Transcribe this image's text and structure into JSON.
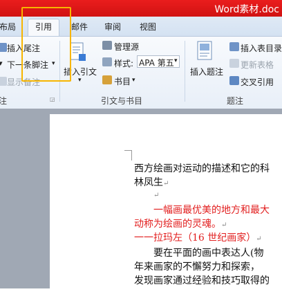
{
  "window": {
    "title": "Word素材.doc"
  },
  "tabs": [
    "布局",
    "引用",
    "邮件",
    "审阅",
    "视图"
  ],
  "ribbon": {
    "footnotes": {
      "insert_endnote": "插入尾注",
      "next_footnote": "下一条脚注",
      "show_notes": "显示备注",
      "group_label": "注"
    },
    "citations": {
      "insert_citation": "插入引文",
      "manage_sources": "管理源",
      "style_label": "样式:",
      "style_value": "APA 第五",
      "bibliography": "书目",
      "group_label": "引文与书目"
    },
    "captions": {
      "insert_caption": "插入题注",
      "insert_table_of_figures": "插入表目录",
      "update_table": "更新表格",
      "cross_reference": "交叉引用",
      "group_label": "题注"
    }
  },
  "document": {
    "lines": [
      "西方绘画对运动的描述和它的科",
      "林凤生",
      "",
      "一幅画最优美的地方和最大",
      "动称为绘画的灵魂。",
      "一一拉玛左（16 世纪画家）",
      "要在平面的画中表达人(物",
      "年来画家的不懈努力和探索，",
      "发现画家通过经验和技巧取得的"
    ],
    "paragraph_mark": "↵"
  },
  "colors": {
    "accent_red": "#e21e1e",
    "highlight": "#f7b500"
  }
}
